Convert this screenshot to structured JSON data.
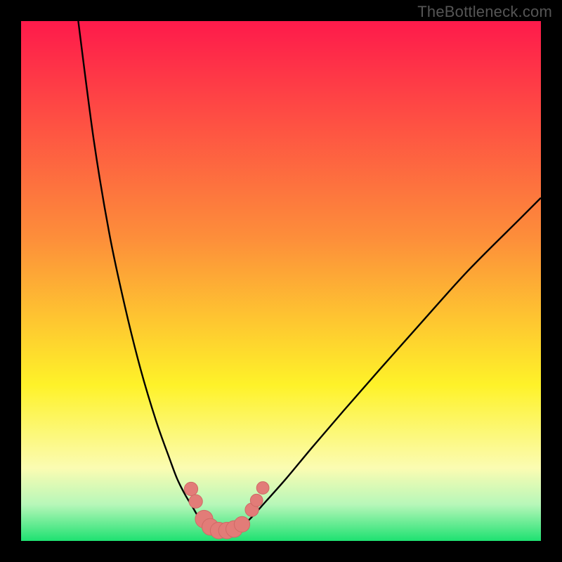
{
  "watermark": "TheBottleneck.com",
  "colors": {
    "black": "#000000",
    "curve": "#000000",
    "marker_fill": "#e27c78",
    "marker_stroke": "#cf6a66",
    "grad_top": "#fe1a4b",
    "grad_mid_orange": "#fd8f3a",
    "grad_yellow": "#fef229",
    "grad_pale_yellow": "#fbfcb2",
    "grad_pale_green": "#b7f7b9",
    "grad_green": "#1ee171"
  },
  "chart_data": {
    "type": "line",
    "title": "",
    "xlabel": "",
    "ylabel": "",
    "xlim": [
      0,
      100
    ],
    "ylim": [
      0,
      100
    ],
    "series": [
      {
        "name": "left-branch",
        "x": [
          11,
          14,
          17,
          20,
          23,
          26,
          28.5,
          30,
          31.5,
          33,
          34,
          35,
          36
        ],
        "y": [
          100,
          77,
          59,
          45,
          33,
          23,
          16,
          12,
          9,
          6.5,
          4.8,
          3.4,
          2.4
        ]
      },
      {
        "name": "right-branch",
        "x": [
          42,
          44,
          47,
          51,
          56,
          62,
          69,
          77,
          86,
          96,
          100
        ],
        "y": [
          2.4,
          4.2,
          7.5,
          12,
          18,
          25,
          33,
          42,
          52,
          62,
          66
        ]
      },
      {
        "name": "floor",
        "x": [
          36,
          38,
          40,
          42
        ],
        "y": [
          2.4,
          2.0,
          2.0,
          2.4
        ]
      }
    ],
    "markers": [
      {
        "x": 32.7,
        "y": 10.0,
        "r": 1.3
      },
      {
        "x": 33.6,
        "y": 7.6,
        "r": 1.3
      },
      {
        "x": 35.2,
        "y": 4.2,
        "r": 1.7
      },
      {
        "x": 36.4,
        "y": 2.7,
        "r": 1.6
      },
      {
        "x": 38.0,
        "y": 2.0,
        "r": 1.6
      },
      {
        "x": 39.6,
        "y": 2.0,
        "r": 1.6
      },
      {
        "x": 41.0,
        "y": 2.3,
        "r": 1.6
      },
      {
        "x": 42.5,
        "y": 3.2,
        "r": 1.5
      },
      {
        "x": 44.4,
        "y": 6.0,
        "r": 1.3
      },
      {
        "x": 45.3,
        "y": 7.8,
        "r": 1.2
      },
      {
        "x": 46.5,
        "y": 10.2,
        "r": 1.2
      }
    ],
    "gradient_stops": [
      {
        "offset": 0.0,
        "color_key": "grad_top"
      },
      {
        "offset": 0.42,
        "color_key": "grad_mid_orange"
      },
      {
        "offset": 0.7,
        "color_key": "grad_yellow"
      },
      {
        "offset": 0.86,
        "color_key": "grad_pale_yellow"
      },
      {
        "offset": 0.93,
        "color_key": "grad_pale_green"
      },
      {
        "offset": 1.0,
        "color_key": "grad_green"
      }
    ]
  }
}
